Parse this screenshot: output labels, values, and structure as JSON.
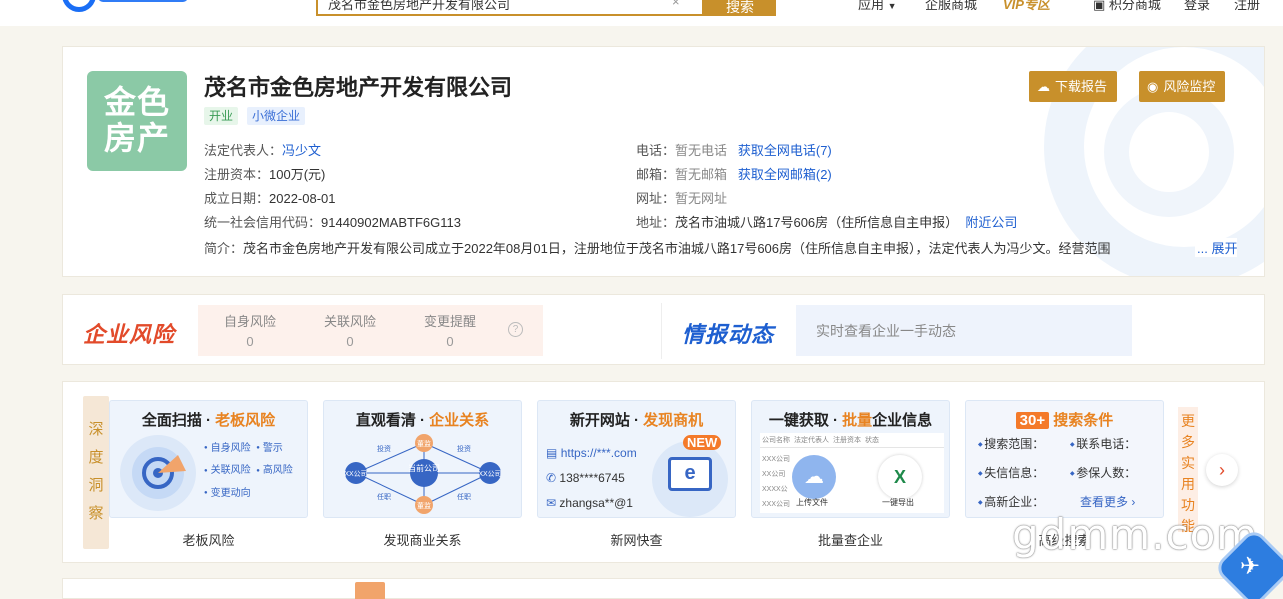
{
  "topbar": {
    "search_value": "茂名市金色房地产开发有限公司",
    "search_button": "搜索",
    "nav": [
      "应用",
      "企服商城",
      "VIP专区",
      "积分商城",
      "登录",
      "注册"
    ]
  },
  "company": {
    "logo_text_line1": "金色",
    "logo_text_line2": "房产",
    "name": "茂名市金色房地产开发有限公司",
    "tags": [
      "开业",
      "小微企业"
    ],
    "legal_rep_label": "法定代表人：",
    "legal_rep": "冯少文",
    "capital_label": "注册资本：",
    "capital": "100万(元)",
    "founded_label": "成立日期：",
    "founded": "2022-08-01",
    "credit_code_label": "统一社会信用代码：",
    "credit_code": "91440902MABTF6G113",
    "phone_label": "电话：",
    "phone": "暂无电话",
    "phone_link": "获取全网电话(7)",
    "email_label": "邮箱：",
    "email": "暂无邮箱",
    "email_link": "获取全网邮箱(2)",
    "website_label": "网址：",
    "website": "暂无网址",
    "address_label": "地址：",
    "address": "茂名市油城八路17号606房（住所信息自主申报）",
    "address_link": "附近公司",
    "intro_label": "简介：",
    "intro": "茂名市金色房地产开发有限公司成立于2022年08月01日，注册地位于茂名市油城八路17号606房（住所信息自主申报），法定代表人为冯少文。经营范围",
    "intro_more": "... 展开",
    "download_btn": "下载报告",
    "monitor_btn": "风险监控"
  },
  "risk": {
    "title": "企业风险",
    "items": [
      {
        "label": "自身风险",
        "value": "0"
      },
      {
        "label": "关联风险",
        "value": "0"
      },
      {
        "label": "变更提醒",
        "value": "0"
      }
    ],
    "help": "?",
    "intel_title": "情报动态",
    "intel_placeholder": "实时查看企业一手动态"
  },
  "features": {
    "deep_tab": "深度洞察",
    "more_tab": "更多实用功能",
    "next": "›",
    "cards": [
      {
        "title_a": "全面扫描 · ",
        "title_b": "老板风险",
        "caption": "老板风险",
        "bullets": [
          "自身风险",
          "警示",
          "关联风险",
          "高风险",
          "变更动向"
        ]
      },
      {
        "title_a": "直观看清 · ",
        "title_b": "企业关系",
        "caption": "发现商业关系",
        "nodes": [
          "当前公司",
          "XX公司",
          "XX公司",
          "董监",
          "投资",
          "投资",
          "任职",
          "任职",
          "董监"
        ]
      },
      {
        "title_a": "新开网站 · ",
        "title_b": "发现商机",
        "caption": "新网快查",
        "lines": [
          "https://***.com",
          "138****6745",
          "zhangsa**@1"
        ],
        "badge": "NEW",
        "letter": "e"
      },
      {
        "title_a": "一键获取 · ",
        "title_b": "批量",
        "title_c": "企业信息",
        "caption": "批量查企业",
        "headers": [
          "公司名称",
          "法定代表人",
          "注册资本",
          "状态"
        ],
        "rows": [
          "XXX公司",
          "XX公司",
          "XXXX公",
          "XXX公司"
        ],
        "upload": "上传文件",
        "export": "一键导出"
      },
      {
        "title_a": "30+",
        "title_b": "搜索条件",
        "caption": "高级搜索",
        "cells": [
          "搜索范围：",
          "联系电话：",
          "失信信息：",
          "参保人数：",
          "高新企业：",
          "查看更多 ›"
        ]
      }
    ]
  },
  "watermark": "gdmm.com",
  "colors": {
    "gold": "#c8902b",
    "risk_red": "#e24a2a",
    "intel_blue": "#1e5fd0",
    "logo_green": "#8bc9a6"
  }
}
